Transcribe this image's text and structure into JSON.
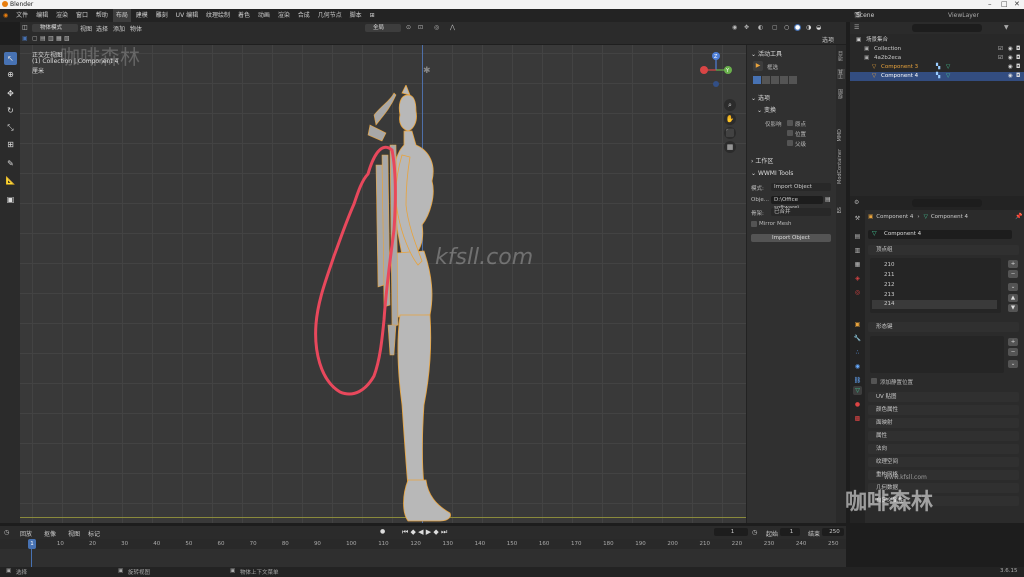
{
  "os_title": "Blender",
  "topbar": {
    "menus": [
      "文件",
      "编辑",
      "渲染",
      "窗口",
      "帮助"
    ],
    "workspaces": [
      "布局",
      "建模",
      "雕刻",
      "UV 编辑",
      "纹理绘制",
      "着色",
      "动画",
      "渲染",
      "合成",
      "几何节点",
      "脚本"
    ],
    "active_workspace_index": 0,
    "scene": "Scene",
    "view_layer": "ViewLayer"
  },
  "viewport_header": {
    "mode": "物体模式",
    "menus": [
      "视图",
      "选择",
      "添加",
      "物体"
    ],
    "orientation": "全局",
    "options_label": "选项"
  },
  "viewport_overlay": {
    "view_name": "正交左视图",
    "collection_line": "(1) Collection | Component 4",
    "unit": "厘米",
    "watermark_center": "kfsll.com",
    "watermark_left": "咖啡森林"
  },
  "npanel": {
    "active_tool_title": "活动工具",
    "select_label": "框选",
    "options_title": "选项",
    "transform_title": "变换",
    "affect_only_label": "仅影响",
    "origins": "原点",
    "locations": "位置",
    "parents": "父级",
    "workspace_title": "工作区",
    "wwmi_title": "WWMI Tools",
    "mode_label": "模式:",
    "mode_value": "Import Object",
    "objects_label": "Obje...",
    "objects_value": "D:\\Office software\\...",
    "skeleton_label": "骨架:",
    "skeleton_value": "已合并",
    "mirror_label": "Mirror Mesh",
    "import_button": "Import Object",
    "tabs": [
      "项目",
      "工具",
      "视图",
      "MMD",
      "ModContainer",
      "BS"
    ]
  },
  "outliner": {
    "title": "场景集合",
    "rows": [
      {
        "label": "Collection",
        "depth": 1,
        "selected": false
      },
      {
        "label": "4a2b2eca",
        "depth": 1,
        "selected": false
      },
      {
        "label": "Component 3",
        "depth": 2,
        "selected": false
      },
      {
        "label": "Component 4",
        "depth": 2,
        "selected": true
      }
    ]
  },
  "properties": {
    "breadcrumb_obj": "Component 4",
    "breadcrumb_mesh": "Component 4",
    "name_value": "Component 4",
    "vertex_groups_title": "顶点组",
    "vertex_groups": [
      "210",
      "211",
      "212",
      "213",
      "214"
    ],
    "shape_keys_title": "形态键",
    "add_rest_position": "添加静置位置",
    "sections": [
      "UV 贴图",
      "颜色属性",
      "面映射",
      "属性",
      "法向",
      "纹理空间",
      "重构网格",
      "几何数据",
      "自定义属性"
    ]
  },
  "timeline": {
    "menus": [
      "回放",
      "抠像",
      "视图",
      "标记"
    ],
    "current_frame": "1",
    "start_label": "起始",
    "start_value": "1",
    "end_label": "结束",
    "end_value": "250",
    "ticks": [
      "1",
      "10",
      "20",
      "30",
      "40",
      "50",
      "60",
      "70",
      "80",
      "90",
      "100",
      "110",
      "120",
      "130",
      "140",
      "150",
      "160",
      "170",
      "180",
      "190",
      "200",
      "210",
      "220",
      "230",
      "240",
      "250"
    ]
  },
  "statusbar": {
    "select": "选择",
    "rotate": "旋转视图",
    "context": "物体上下文菜单",
    "version": "3.6.15"
  },
  "watermark_br": "咖啡森林",
  "watermark_br_url": "www.kfsll.com",
  "colors": {
    "accent": "#4772b3",
    "selection_orange": "#e8a33c",
    "annotation_red": "#e8485c",
    "viewport_bg": "#393939"
  }
}
